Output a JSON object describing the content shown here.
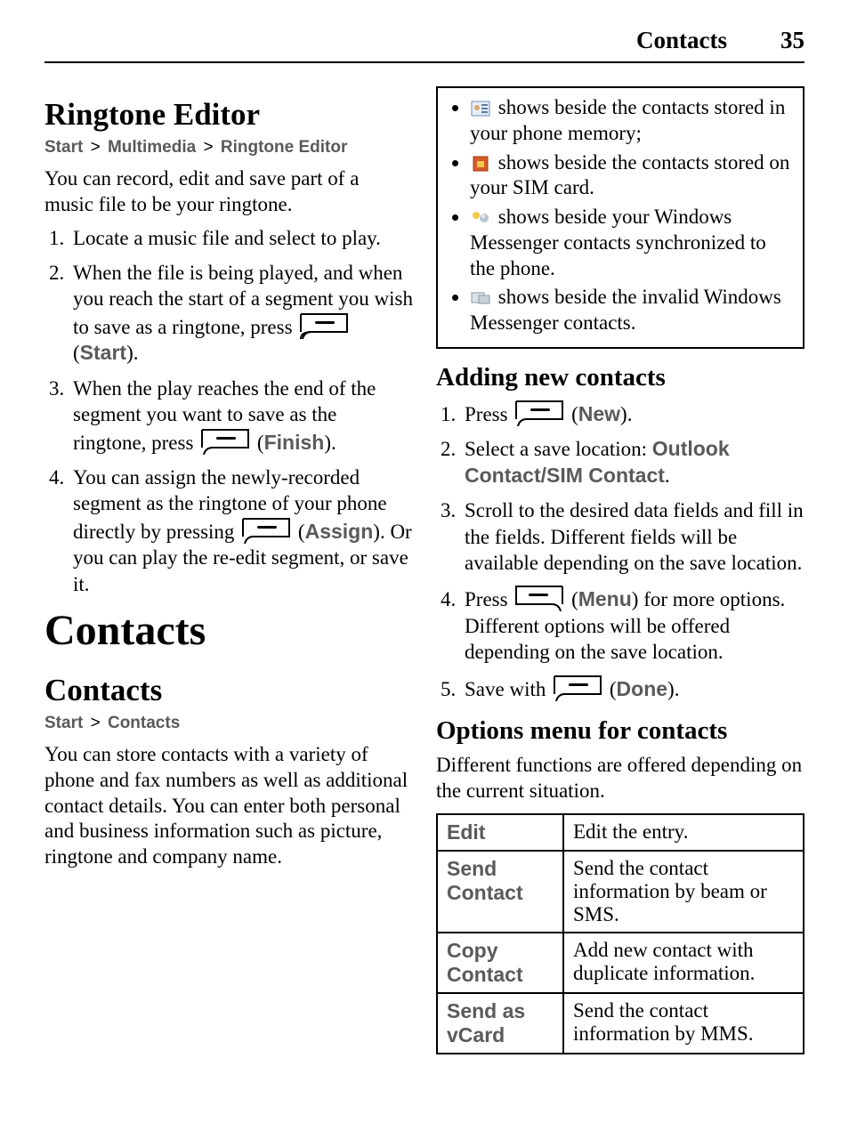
{
  "header": {
    "section": "Contacts",
    "page_no": "35"
  },
  "left": {
    "h2_ringtone": "Ringtone Editor",
    "bc_ringtone": {
      "a": "Start",
      "b": "Multimedia",
      "c": "Ringtone Editor"
    },
    "p_ringtone_intro": "You can record, edit and save part of a music file to be your ringtone.",
    "steps_ringtone": [
      "Locate a music file and select to play.",
      {
        "pre": "When the file is being played, and when you reach the start of a segment you wish to save as a ringtone, press ",
        "key_side": "left",
        "label": "Start",
        "post": "."
      },
      {
        "pre": "When the play reaches the end of the segment you want to save as the ringtone, press ",
        "key_side": "left",
        "label": "Finish",
        "post": "."
      },
      {
        "pre": "You can assign the newly-recorded segment as the ringtone of your phone directly by pressing ",
        "key_side": "left",
        "label": "Assign",
        "post": ". Or you can play the re-edit segment, or save it."
      }
    ],
    "h1_contacts": "Contacts",
    "h2_contacts": "Contacts",
    "bc_contacts": {
      "a": "Start",
      "b": "Contacts"
    },
    "p_contacts_intro": "You can store contacts with a variety of phone and fax numbers as well as additional contact details. You can enter both personal and business information such as picture, ringtone and company name."
  },
  "right": {
    "icon_list": [
      {
        "icon": "phone-contact-icon",
        "text_a": " shows beside the contacts stored in your phone memory;"
      },
      {
        "icon": "sim-contact-icon",
        "text_a": " shows beside the contacts stored on your SIM card."
      },
      {
        "icon": "messenger-contact-icon",
        "text_a": " shows beside your Windows Messenger contacts synchronized to the phone."
      },
      {
        "icon": "invalid-messenger-icon",
        "text_a": " shows beside the invalid Windows Messenger contacts."
      }
    ],
    "h3_adding": "Adding new contacts",
    "steps_adding": [
      {
        "pre": "Press ",
        "key_side": "left",
        "label": "New",
        "post": "."
      },
      {
        "pre": "Select a save location: ",
        "bold": "Outlook Contact/SIM Contact",
        "post": "."
      },
      "Scroll to the desired data fields and fill in the fields. Different fields will be available depending on the save location.",
      {
        "pre": "Press ",
        "key_side": "right",
        "label": "Menu",
        "post": " for more options. Different options will be offered depending on the save location."
      },
      {
        "pre": "Save with ",
        "key_side": "left",
        "label": "Done",
        "post": "."
      }
    ],
    "h3_options": "Options menu for contacts",
    "p_options_intro": "Different functions are offered depending on the current situation.",
    "options_table": [
      {
        "k": "Edit",
        "v": "Edit the entry."
      },
      {
        "k": "Send Contact",
        "v": "Send the contact information by beam or SMS."
      },
      {
        "k": "Copy Contact",
        "v": "Add new contact with duplicate information."
      },
      {
        "k": "Send as vCard",
        "v": "Send the contact information by MMS."
      }
    ]
  }
}
